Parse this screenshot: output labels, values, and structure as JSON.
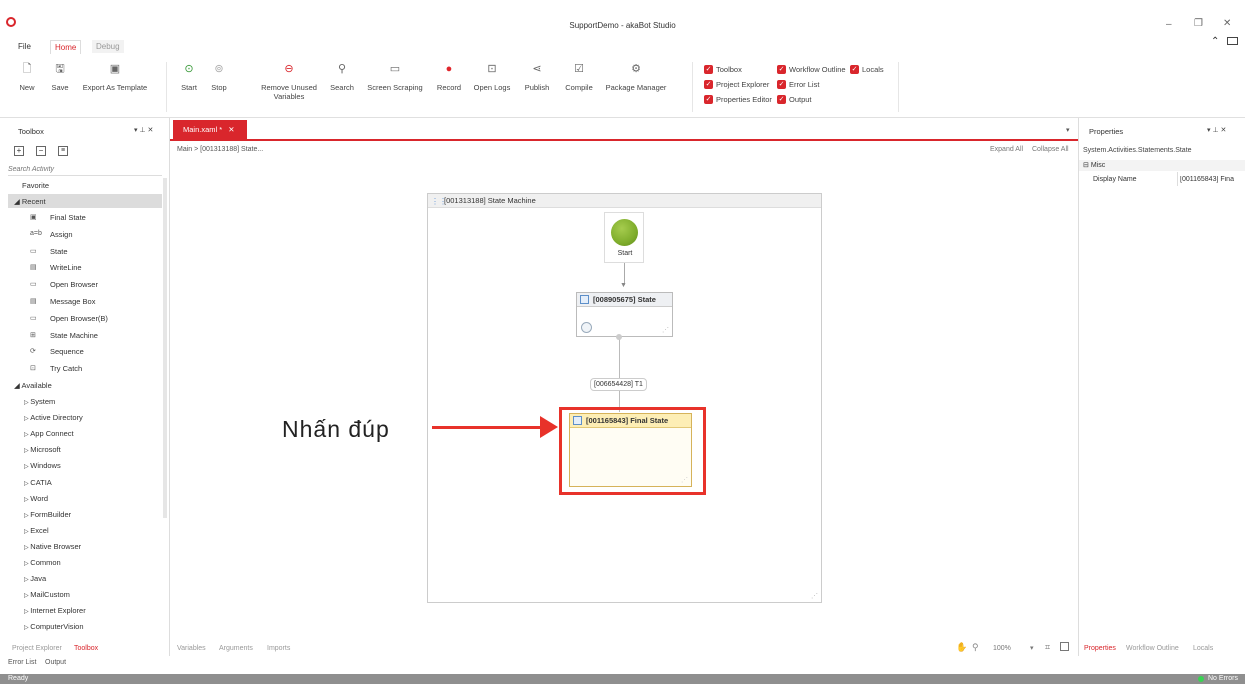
{
  "window": {
    "title": "SupportDemo - akaBot Studio",
    "minimize": "–",
    "restore": "❐",
    "close": "✕"
  },
  "menu_tabs": [
    {
      "label": "File"
    },
    {
      "label": "Home"
    },
    {
      "label": "Debug"
    }
  ],
  "ribbon": {
    "buttons": [
      {
        "label": "New",
        "icon": "new-file-icon"
      },
      {
        "label": "Save",
        "icon": "save-icon"
      },
      {
        "label": "Export As Template",
        "icon": "export-template-icon"
      },
      {
        "label": "Start",
        "icon": "play-icon"
      },
      {
        "label": "Stop",
        "icon": "stop-icon"
      },
      {
        "label": "Remove Unused Variables",
        "icon": "remove-icon"
      },
      {
        "label": "Search",
        "icon": "search-icon"
      },
      {
        "label": "Screen Scraping",
        "icon": "screen-icon"
      },
      {
        "label": "Record",
        "icon": "record-icon"
      },
      {
        "label": "Open Logs",
        "icon": "logs-icon"
      },
      {
        "label": "Publish",
        "icon": "share-icon"
      },
      {
        "label": "Compile",
        "icon": "compile-icon"
      },
      {
        "label": "Package Manager",
        "icon": "package-icon"
      }
    ],
    "checks": [
      {
        "label": "Toolbox"
      },
      {
        "label": "Workflow Outline"
      },
      {
        "label": "Locals"
      },
      {
        "label": "Project Explorer"
      },
      {
        "label": "Error List"
      },
      {
        "label": "Properties Editor"
      },
      {
        "label": "Output"
      }
    ]
  },
  "toolbox": {
    "title": "Toolbox",
    "search_placeholder": "Search Activity",
    "favorite": "Favorite",
    "recent_label": "Recent",
    "recent": [
      {
        "label": "Final State",
        "icon": "final-state-icon"
      },
      {
        "label": "Assign",
        "icon": "assign-icon"
      },
      {
        "label": "State",
        "icon": "state-icon"
      },
      {
        "label": "WriteLine",
        "icon": "writeline-icon"
      },
      {
        "label": "Open Browser",
        "icon": "browser-icon"
      },
      {
        "label": "Message Box",
        "icon": "message-box-icon"
      },
      {
        "label": "Open Browser(B)",
        "icon": "browser-icon"
      },
      {
        "label": "State Machine",
        "icon": "state-machine-icon"
      },
      {
        "label": "Sequence",
        "icon": "sequence-icon"
      },
      {
        "label": "Try Catch",
        "icon": "try-catch-icon"
      }
    ],
    "available_label": "Available",
    "available": [
      "System",
      "Active Directory",
      "App Connect",
      "Microsoft",
      "Windows",
      "CATIA",
      "Word",
      "FormBuilder",
      "Excel",
      "Native Browser",
      "Common",
      "Java",
      "MailCustom",
      "Internet Explorer",
      "ComputerVision"
    ]
  },
  "document": {
    "tab": "Main.xaml *",
    "breadcrumb": "Main > [001313188] State...",
    "expand_all": "Expand All",
    "collapse_all": "Collapse All",
    "state_machine": "[001313188] State Machine",
    "start_label": "Start",
    "state": "[008905675] State",
    "transition": "[006654428] T1",
    "final_state": "[001165843] Final State",
    "annotation": "Nhấn đúp",
    "zoom": "100%",
    "bottom_tabs": [
      "Variables",
      "Arguments",
      "Imports"
    ]
  },
  "properties": {
    "title": "Properties",
    "type": "System.Activities.Statements.State",
    "category": "Misc",
    "rows": [
      {
        "name": "Display Name",
        "value": "[001165843] Fina"
      }
    ],
    "tabs": [
      "Properties",
      "Workflow Outline",
      "Locals"
    ]
  },
  "left_bottom_tabs": [
    "Project Explorer",
    "Toolbox"
  ],
  "output_tabs": [
    "Error List",
    "Output"
  ],
  "status": {
    "left": "Ready",
    "right": "No Errors"
  },
  "colors": {
    "accent": "#d9262c",
    "highlight": "#e8322a",
    "start_node": "#7fad2c"
  }
}
